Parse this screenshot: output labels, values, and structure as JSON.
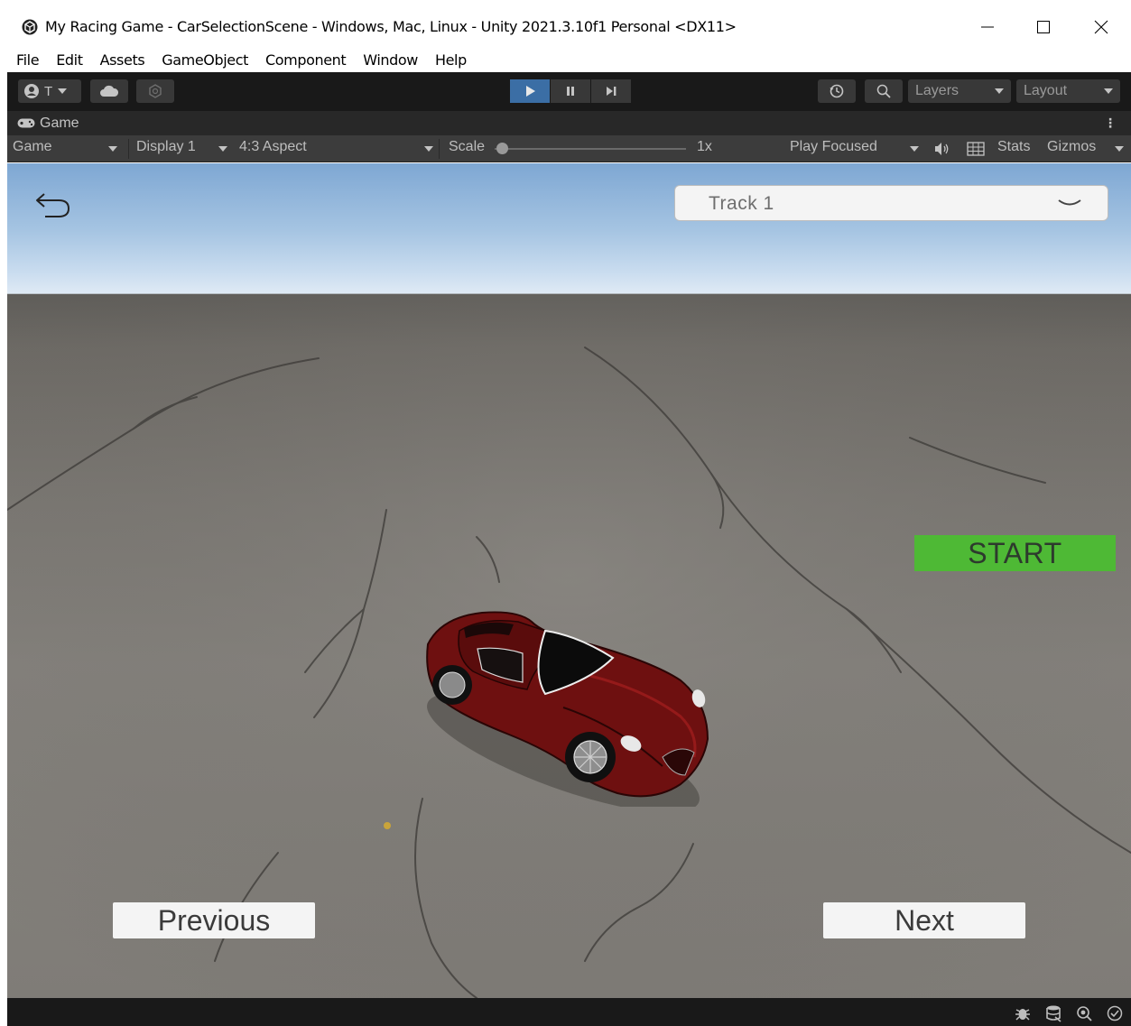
{
  "window": {
    "title": "My Racing Game - CarSelectionScene - Windows, Mac, Linux - Unity 2021.3.10f1 Personal <DX11>",
    "controls": [
      "minimize-icon",
      "maximize-icon",
      "close-icon"
    ]
  },
  "menu": {
    "items": [
      "File",
      "Edit",
      "Assets",
      "GameObject",
      "Component",
      "Window",
      "Help"
    ]
  },
  "toolbar": {
    "account_label": "T",
    "play_state": "playing",
    "layers_label": "Layers",
    "layout_label": "Layout"
  },
  "game_tab": {
    "label": "Game"
  },
  "game_bar": {
    "view_mode": "Game",
    "display": "Display 1",
    "aspect": "4:3 Aspect",
    "scale_label": "Scale",
    "scale_value": "1x",
    "play_mode": "Play Focused",
    "stats": "Stats",
    "gizmos": "Gizmos"
  },
  "game": {
    "track_dropdown": "Track 1",
    "start_button": "START",
    "previous_button": "Previous",
    "next_button": "Next",
    "car_color": "#7a1212",
    "start_color": "#4eb935"
  },
  "colors": {
    "toolbar_bg": "#191919",
    "play_active": "#3b6ea5",
    "panel_bg": "#3c3c3c"
  }
}
